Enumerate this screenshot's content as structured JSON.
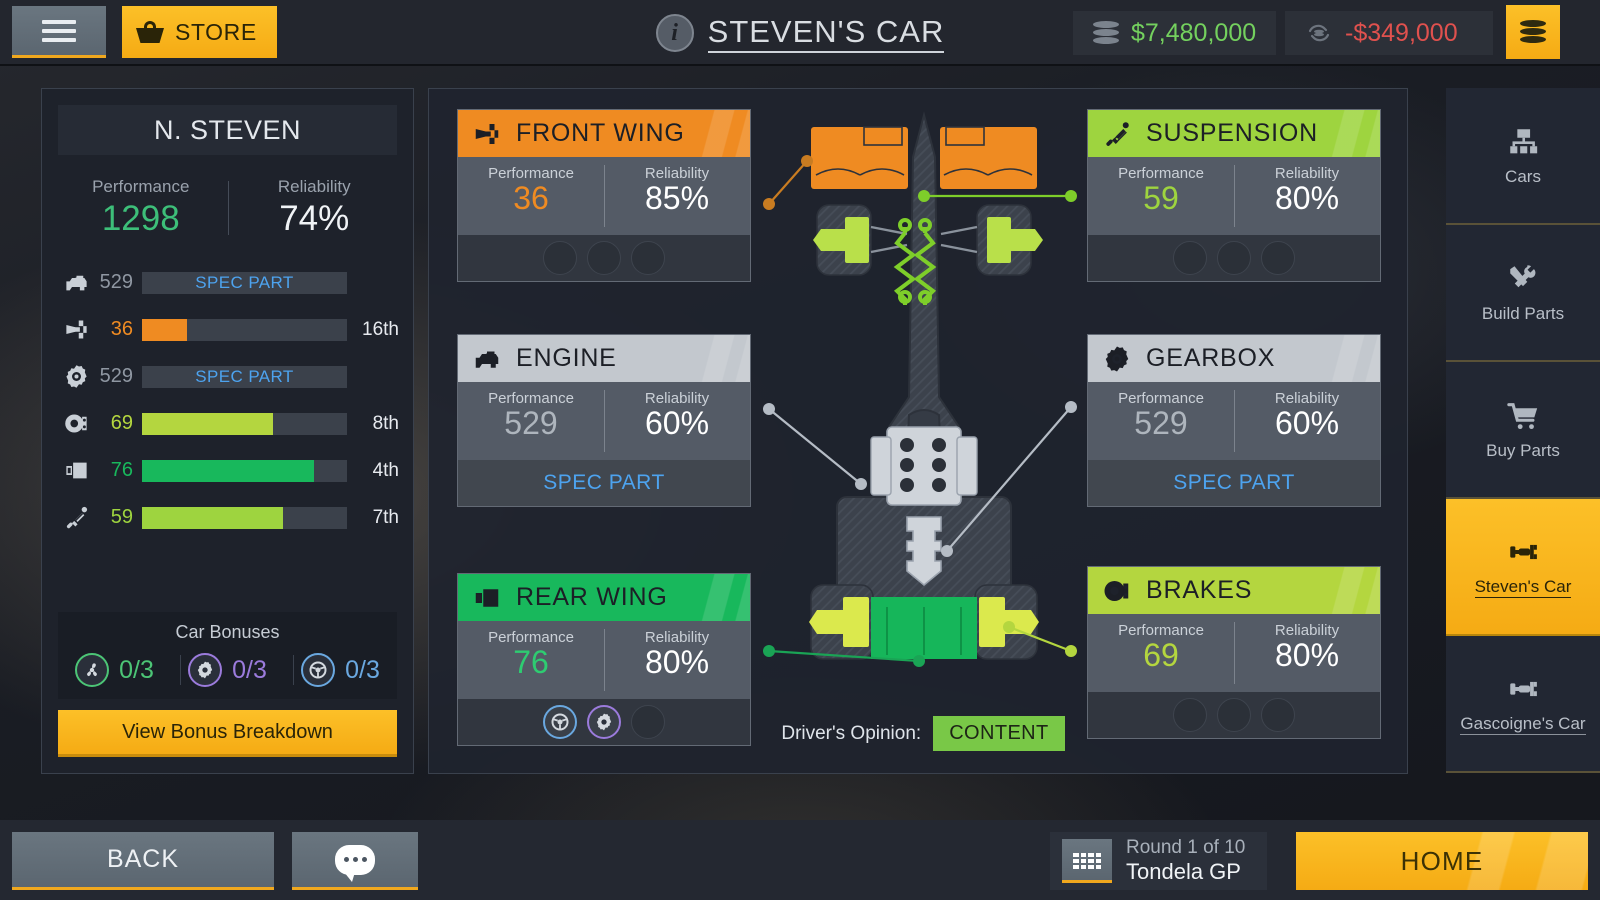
{
  "topbar": {
    "menu_icon": "hamburger-menu-icon",
    "store_label": "STORE",
    "store_icon": "basket-icon",
    "info_icon": "info-icon",
    "title": "STEVEN'S CAR",
    "cash": "$7,480,000",
    "cash_icon": "coin-stack-icon",
    "debt": "-$349,000",
    "debt_icon": "recycle-coin-icon",
    "coin_button_icon": "coin-stack-icon",
    "colors": {
      "cash": "#74d15e",
      "debt": "#e0514e",
      "accent": "#f5ab14"
    }
  },
  "left_panel": {
    "driver_name": "N. STEVEN",
    "performance_label": "Performance",
    "performance_value": "1298",
    "reliability_label": "Reliability",
    "reliability_value": "74%",
    "stats": [
      {
        "icon": "engine-icon",
        "value": "529",
        "spec_text": "SPEC PART",
        "is_spec": true,
        "pct": 0,
        "rank": "",
        "color": "#8f97a2"
      },
      {
        "icon": "front-wing-icon",
        "value": "36",
        "spec_text": "",
        "is_spec": false,
        "pct": 22,
        "rank": "16th",
        "color": "#ef8b22"
      },
      {
        "icon": "gearbox-icon",
        "value": "529",
        "spec_text": "SPEC PART",
        "is_spec": true,
        "pct": 0,
        "rank": "",
        "color": "#8f97a2"
      },
      {
        "icon": "brakes-icon",
        "value": "69",
        "spec_text": "",
        "is_spec": false,
        "pct": 64,
        "rank": "8th",
        "color": "#b4d63f"
      },
      {
        "icon": "rear-wing-icon",
        "value": "76",
        "spec_text": "",
        "is_spec": false,
        "pct": 84,
        "rank": "4th",
        "color": "#18b85c"
      },
      {
        "icon": "suspension-icon",
        "value": "59",
        "spec_text": "",
        "is_spec": false,
        "pct": 69,
        "rank": "7th",
        "color": "#9ed43f"
      }
    ],
    "bonuses_title": "Car Bonuses",
    "bonuses": [
      {
        "icon": "aero-fan-icon",
        "count": "0/3",
        "color": "#4cc576"
      },
      {
        "icon": "gear-cog-icon",
        "count": "0/3",
        "color": "#9b7bdc"
      },
      {
        "icon": "steering-wheel-icon",
        "count": "0/3",
        "color": "#6aa8e0"
      }
    ],
    "bonus_button": "View Bonus Breakdown"
  },
  "parts": [
    {
      "id": "front-wing",
      "name": "FRONT WING",
      "icon": "front-wing-icon",
      "header_color": "#ef8b22",
      "perf_color": "#ef8b22",
      "performance_label": "Performance",
      "performance_value": "36",
      "reliability_label": "Reliability",
      "reliability_value": "85%",
      "footer_type": "slots",
      "spec_text": "",
      "slots": [
        {
          "filled": false,
          "icon": "",
          "color": ""
        },
        {
          "filled": false,
          "icon": "",
          "color": ""
        },
        {
          "filled": false,
          "icon": "",
          "color": ""
        }
      ]
    },
    {
      "id": "engine",
      "name": "ENGINE",
      "icon": "engine-icon",
      "header_color": "#c3c8ce",
      "perf_color": "#aeb5bd",
      "performance_label": "Performance",
      "performance_value": "529",
      "reliability_label": "Reliability",
      "reliability_value": "60%",
      "footer_type": "spec",
      "spec_text": "SPEC PART",
      "slots": []
    },
    {
      "id": "rear-wing",
      "name": "REAR WING",
      "icon": "rear-wing-icon",
      "header_color": "#18b85c",
      "perf_color": "#2ecc71",
      "performance_label": "Performance",
      "performance_value": "76",
      "reliability_label": "Reliability",
      "reliability_value": "80%",
      "footer_type": "slots",
      "spec_text": "",
      "slots": [
        {
          "filled": true,
          "icon": "steering-wheel-icon",
          "color": "#6aa8e0"
        },
        {
          "filled": true,
          "icon": "gear-cog-icon",
          "color": "#9b7bdc"
        },
        {
          "filled": false,
          "icon": "",
          "color": ""
        }
      ]
    },
    {
      "id": "suspension",
      "name": "SUSPENSION",
      "icon": "suspension-icon",
      "header_color": "#9ed43f",
      "perf_color": "#9ed43f",
      "performance_label": "Performance",
      "performance_value": "59",
      "reliability_label": "Reliability",
      "reliability_value": "80%",
      "footer_type": "slots",
      "spec_text": "",
      "slots": [
        {
          "filled": false,
          "icon": "",
          "color": ""
        },
        {
          "filled": false,
          "icon": "",
          "color": ""
        },
        {
          "filled": false,
          "icon": "",
          "color": ""
        }
      ]
    },
    {
      "id": "gearbox",
      "name": "GEARBOX",
      "icon": "gearbox-icon",
      "header_color": "#c3c8ce",
      "perf_color": "#aeb5bd",
      "performance_label": "Performance",
      "performance_value": "529",
      "reliability_label": "Reliability",
      "reliability_value": "60%",
      "footer_type": "spec",
      "spec_text": "SPEC PART",
      "slots": []
    },
    {
      "id": "brakes",
      "name": "BRAKES",
      "icon": "brakes-icon",
      "header_color": "#b4d63f",
      "perf_color": "#b4d63f",
      "performance_label": "Performance",
      "performance_value": "69",
      "reliability_label": "Reliability",
      "reliability_value": "80%",
      "footer_type": "slots",
      "spec_text": "",
      "slots": [
        {
          "filled": false,
          "icon": "",
          "color": ""
        },
        {
          "filled": false,
          "icon": "",
          "color": ""
        },
        {
          "filled": false,
          "icon": "",
          "color": ""
        }
      ]
    }
  ],
  "driver_opinion": {
    "label": "Driver's Opinion:",
    "value": "CONTENT",
    "color": "#79c847"
  },
  "right_nav": [
    {
      "id": "cars",
      "label": "Cars",
      "icon": "org-chart-icon",
      "active": false,
      "underline": false
    },
    {
      "id": "build-parts",
      "label": "Build Parts",
      "icon": "tools-icon",
      "active": false,
      "underline": false
    },
    {
      "id": "buy-parts",
      "label": "Buy Parts",
      "icon": "shopping-cart-icon",
      "active": false,
      "underline": false
    },
    {
      "id": "stevens-car",
      "label": "Steven's Car",
      "icon": "race-car-icon",
      "active": true,
      "underline": true
    },
    {
      "id": "gascoignes-car",
      "label": "Gascoigne's Car",
      "icon": "race-car-icon",
      "active": false,
      "underline": true
    }
  ],
  "bottom": {
    "back_label": "BACK",
    "chat_icon": "speech-bubble-icon",
    "calendar_icon": "calendar-icon",
    "round_line1": "Round 1 of 10",
    "round_line2": "Tondela GP",
    "home_label": "HOME"
  }
}
